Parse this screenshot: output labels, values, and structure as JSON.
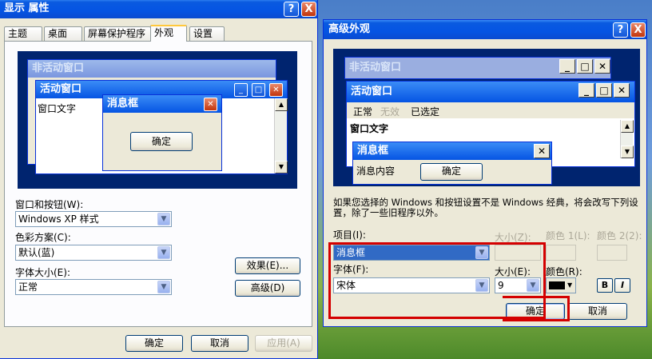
{
  "display_props": {
    "title": "显示 属性",
    "help": "?",
    "close": "X",
    "tabs": [
      "主题",
      "桌面",
      "屏幕保护程序",
      "外观",
      "设置"
    ],
    "preview": {
      "inactive_title": "非活动窗口",
      "active_title": "活动窗口",
      "window_text": "窗口文字",
      "msgbox_title": "消息框",
      "msgbox_ok": "确定"
    },
    "windows_buttons_label": "窗口和按钮(W):",
    "windows_buttons_value": "Windows XP 样式",
    "color_scheme_label": "色彩方案(C):",
    "color_scheme_value": "默认(蓝)",
    "font_size_label": "字体大小(E):",
    "font_size_value": "正常",
    "effects_button": "效果(E)...",
    "advanced_button": "高级(D)",
    "ok_button": "确定",
    "cancel_button": "取消",
    "apply_button": "应用(A)"
  },
  "advanced": {
    "title": "高级外观",
    "help": "?",
    "close": "X",
    "preview": {
      "inactive_title": "非活动窗口",
      "active_title": "活动窗口",
      "menu_normal": "正常",
      "menu_disabled": "无效",
      "menu_selected": "已选定",
      "window_text": "窗口文字",
      "msgbox_title": "消息框",
      "msgbox_content": "消息内容",
      "msgbox_ok": "确定"
    },
    "description": "如果您选择的 Windows 和按钮设置不是 Windows 经典，将会改写下列设置，除了一些旧程序以外。",
    "item_label": "项目(I):",
    "item_value": "消息框",
    "size_label": "大小(Z):",
    "color1_label": "颜色 1(L):",
    "color2_label": "颜色 2(2):",
    "font_label": "字体(F):",
    "font_value": "宋体",
    "font_size_label": "大小(E):",
    "font_size_value": "9",
    "font_color_label": "颜色(R):",
    "font_color": "#000000",
    "bold_label": "B",
    "italic_label": "I",
    "ok_button": "确定",
    "cancel_button": "取消"
  },
  "colors": {
    "title_blue": "#0554e3",
    "highlight": "#d40000"
  }
}
